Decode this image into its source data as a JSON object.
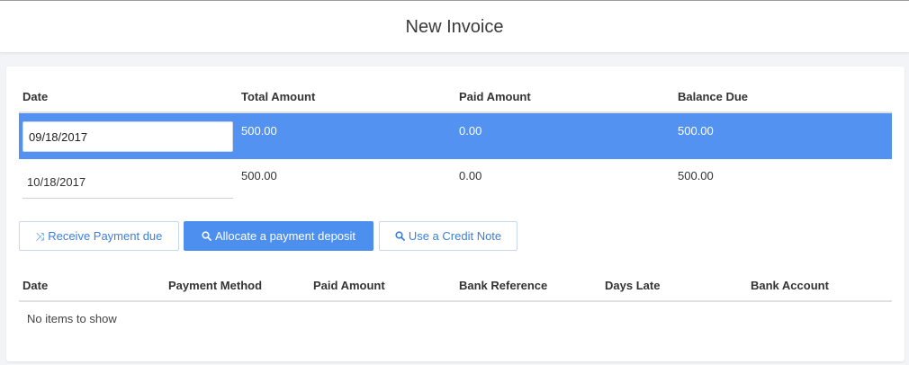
{
  "page": {
    "title": "New Invoice"
  },
  "installments": {
    "headers": [
      "Date",
      "Total Amount",
      "Paid Amount",
      "Balance Due"
    ],
    "rows": [
      {
        "date": "09/18/2017",
        "total": "500.00",
        "paid": "0.00",
        "balance": "500.00",
        "selected": true
      },
      {
        "date": "10/18/2017",
        "total": "500.00",
        "paid": "0.00",
        "balance": "500.00",
        "selected": false
      }
    ]
  },
  "actions": {
    "receive_payment": {
      "label": "Receive Payment due",
      "icon": "shuffle-icon"
    },
    "allocate_deposit": {
      "label": "Allocate a payment deposit",
      "icon": "search-icon"
    },
    "use_credit_note": {
      "label": "Use a Credit Note",
      "icon": "search-icon"
    }
  },
  "payments": {
    "headers": [
      "Date",
      "Payment Method",
      "Paid Amount",
      "Bank Reference",
      "Days Late",
      "Bank Account"
    ],
    "empty_text": "No items to show"
  },
  "colors": {
    "accent": "#4d8fef",
    "selected_row": "#5392f1"
  }
}
